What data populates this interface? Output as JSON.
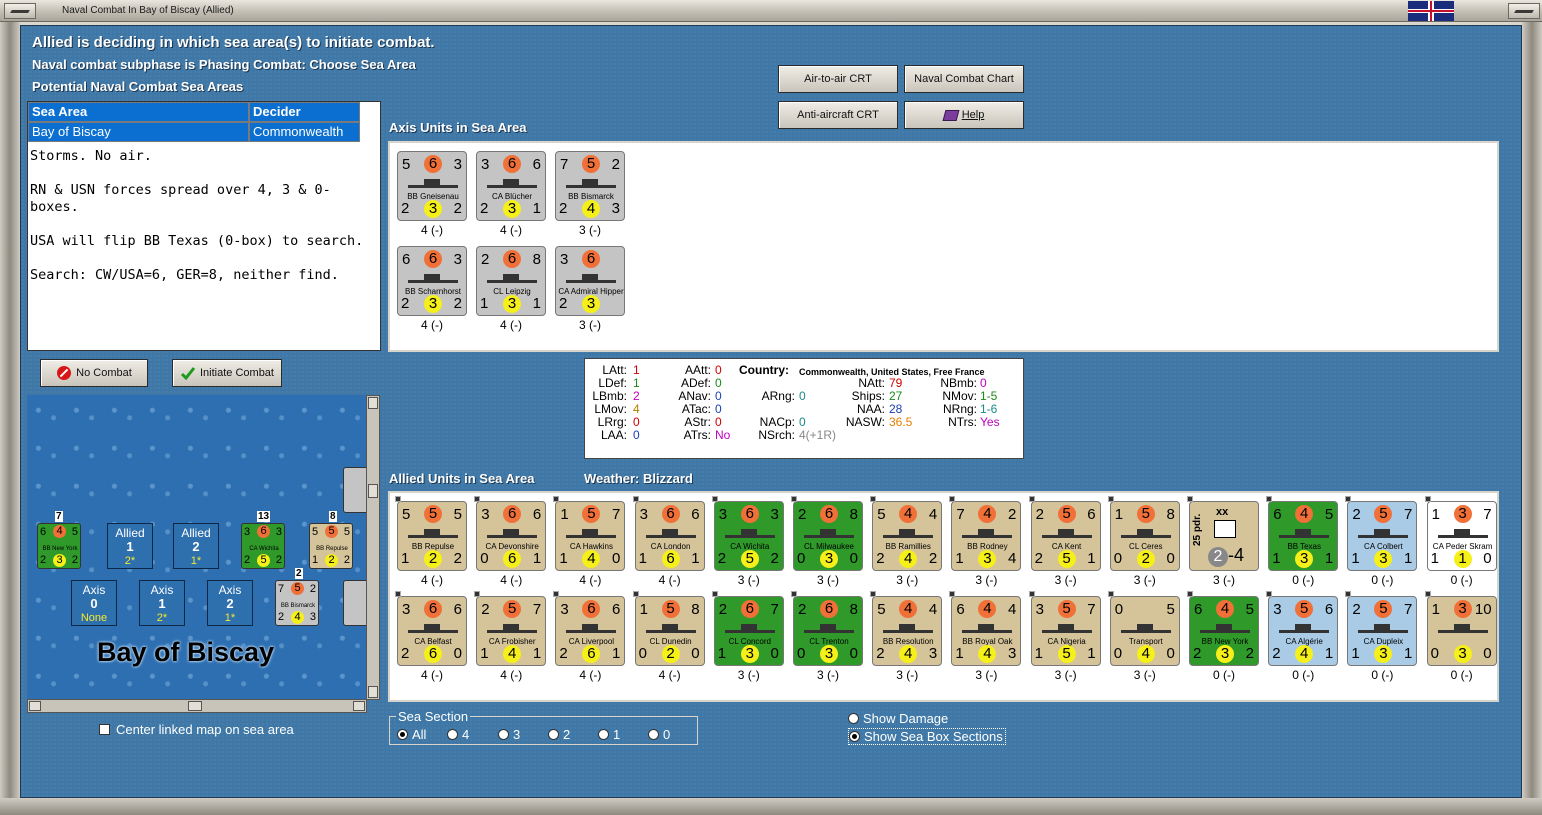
{
  "window": {
    "title": "Naval Combat In Bay of Biscay (Allied)"
  },
  "header": {
    "line1": "Allied is deciding in which sea area(s) to initiate combat.",
    "line2": "Naval combat subphase is Phasing Combat: Choose Sea Area",
    "line3": "Potential Naval Combat Sea Areas"
  },
  "table": {
    "headers": [
      "Sea Area",
      "Decider"
    ],
    "rows": [
      [
        "Bay of Biscay",
        "Commonwealth"
      ]
    ]
  },
  "notes": [
    "Storms.  No air.",
    "RN & USN forces spread over 4, 3 & 0-boxes.",
    "USA will flip BB Texas (0-box) to search.",
    "Search:  CW/USA=6, GER=8, neither find."
  ],
  "buttons": {
    "air_to_air": "Air-to-air CRT",
    "naval_chart": "Naval Combat Chart",
    "anti_aircraft": "Anti-aircraft CRT",
    "help": "Help",
    "no_combat": "No Combat",
    "initiate_combat": "Initiate Combat"
  },
  "axis_section": {
    "title": "Axis Units in Sea Area"
  },
  "allied_section": {
    "title": "Allied Units in Sea Area",
    "weather": "Weather:  Blizzard"
  },
  "info": {
    "country_label": "Country:",
    "country_value": "Commonwealth, United States, Free France",
    "col1": [
      [
        "LAtt:",
        "1"
      ],
      [
        "LDef:",
        "1"
      ],
      [
        "LBmb:",
        "2"
      ],
      [
        "LMov:",
        "4"
      ],
      [
        "LRrg:",
        "0"
      ],
      [
        "LAA:",
        "0"
      ]
    ],
    "col2": [
      [
        "AAtt:",
        "0"
      ],
      [
        "ADef:",
        "0"
      ],
      [
        "ANav:",
        "0"
      ],
      [
        "ATac:",
        "0"
      ],
      [
        "AStr:",
        "0"
      ],
      [
        "ATrs:",
        "No"
      ]
    ],
    "col3": [
      [
        "ARng:",
        "0"
      ],
      [
        "NACp:",
        "0"
      ],
      [
        "NSrch:",
        "4(+1R)"
      ]
    ],
    "col4": [
      [
        "NAtt:",
        "79"
      ],
      [
        "Ships:",
        "27"
      ],
      [
        "NAA:",
        "28"
      ],
      [
        "NASW:",
        "36.5"
      ]
    ],
    "col5": [
      [
        "NBmb:",
        "0"
      ],
      [
        "NMov:",
        "1-5"
      ],
      [
        "NRng:",
        "1-6"
      ],
      [
        "NTrs:",
        "Yes"
      ]
    ]
  },
  "axis_units": [
    {
      "name": "BB Gneisenau",
      "a": "5",
      "o": "6",
      "b": "3",
      "c": "2",
      "y": "3",
      "d": "2",
      "sub": "4 (-)"
    },
    {
      "name": "CA Blücher",
      "a": "3",
      "o": "6",
      "b": "6",
      "c": "2",
      "y": "3",
      "d": "1",
      "sub": "4 (-)"
    },
    {
      "name": "BB Bismarck",
      "a": "7",
      "o": "5",
      "b": "2",
      "c": "2",
      "y": "4",
      "d": "3",
      "sub": "3 (-)"
    },
    {
      "name": "BB Scharnhorst",
      "a": "6",
      "o": "6",
      "b": "3",
      "c": "2",
      "y": "3",
      "d": "2",
      "sub": "4 (-)"
    },
    {
      "name": "CL Leipzig",
      "a": "2",
      "o": "6",
      "b": "8",
      "c": "1",
      "y": "3",
      "d": "1",
      "sub": "4 (-)"
    },
    {
      "name": "CA Admiral Hipper",
      "a": "3",
      "o": "6",
      "b": "",
      "c": "2",
      "y": "3",
      "d": "",
      "sub": "3 (-)"
    }
  ],
  "allied_row1": [
    {
      "name": "BB Repulse",
      "a": "5",
      "o": "5",
      "b": "5",
      "c": "1",
      "y": "2",
      "d": "2",
      "sub": "4 (-)",
      "color": "tan"
    },
    {
      "name": "CA Devonshire",
      "a": "3",
      "o": "6",
      "b": "6",
      "c": "0",
      "y": "6",
      "d": "1",
      "sub": "4 (-)",
      "color": "tan"
    },
    {
      "name": "CA Hawkins",
      "a": "1",
      "o": "5",
      "b": "7",
      "c": "1",
      "y": "4",
      "d": "0",
      "sub": "4 (-)",
      "color": "tan"
    },
    {
      "name": "CA London",
      "a": "3",
      "o": "6",
      "b": "6",
      "c": "1",
      "y": "6",
      "d": "1",
      "sub": "4 (-)",
      "color": "tan"
    },
    {
      "name": "CA Wichita",
      "a": "3",
      "o": "6",
      "b": "3",
      "c": "2",
      "y": "5",
      "d": "2",
      "sub": "3 (-)",
      "color": "green"
    },
    {
      "name": "CL Milwaukee",
      "a": "2",
      "o": "6",
      "b": "8",
      "c": "0",
      "y": "3",
      "d": "0",
      "sub": "3 (-)",
      "color": "green"
    },
    {
      "name": "BB Ramillies",
      "a": "5",
      "o": "4",
      "b": "4",
      "c": "2",
      "y": "4",
      "d": "2",
      "sub": "3 (-)",
      "color": "tan"
    },
    {
      "name": "BB Rodney",
      "a": "7",
      "o": "4",
      "b": "2",
      "c": "1",
      "y": "3",
      "d": "4",
      "sub": "3 (-)",
      "color": "tan"
    },
    {
      "name": "CA Kent",
      "a": "2",
      "o": "5",
      "b": "6",
      "c": "2",
      "y": "5",
      "d": "1",
      "sub": "3 (-)",
      "color": "tan"
    },
    {
      "name": "CL Ceres",
      "a": "1",
      "o": "5",
      "b": "8",
      "c": "0",
      "y": "2",
      "d": "0",
      "sub": "3 (-)",
      "color": "tan"
    },
    {
      "name": "25 pdr.",
      "a": "",
      "o": "",
      "b": "",
      "c": "2",
      "y": "",
      "d": "4",
      "sub": "3 (-)",
      "color": "tan",
      "special": "xx"
    },
    {
      "name": "BB Texas",
      "a": "6",
      "o": "4",
      "b": "5",
      "c": "1",
      "y": "3",
      "d": "1",
      "sub": "0 (-)",
      "color": "green"
    },
    {
      "name": "CA Colbert",
      "a": "2",
      "o": "5",
      "b": "7",
      "c": "1",
      "y": "3",
      "d": "1",
      "sub": "0 (-)",
      "color": "blue"
    },
    {
      "name": "CA Peder Skram",
      "a": "1",
      "o": "3",
      "b": "7",
      "c": "1",
      "y": "1",
      "d": "0",
      "sub": "0 (-)",
      "color": "white"
    }
  ],
  "allied_row2": [
    {
      "name": "CA Belfast",
      "a": "3",
      "o": "6",
      "b": "6",
      "c": "2",
      "y": "6",
      "d": "0",
      "sub": "4 (-)",
      "color": "tan"
    },
    {
      "name": "CA Frobisher",
      "a": "2",
      "o": "5",
      "b": "7",
      "c": "1",
      "y": "4",
      "d": "1",
      "sub": "4 (-)",
      "color": "tan"
    },
    {
      "name": "CA Liverpool",
      "a": "3",
      "o": "6",
      "b": "6",
      "c": "2",
      "y": "6",
      "d": "1",
      "sub": "4 (-)",
      "color": "tan"
    },
    {
      "name": "CL Dunedin",
      "a": "1",
      "o": "5",
      "b": "8",
      "c": "0",
      "y": "2",
      "d": "0",
      "sub": "4 (-)",
      "color": "tan"
    },
    {
      "name": "CL Concord",
      "a": "2",
      "o": "6",
      "b": "7",
      "c": "1",
      "y": "3",
      "d": "0",
      "sub": "3 (-)",
      "color": "green"
    },
    {
      "name": "CL Trenton",
      "a": "2",
      "o": "6",
      "b": "8",
      "c": "0",
      "y": "3",
      "d": "0",
      "sub": "3 (-)",
      "color": "green"
    },
    {
      "name": "BB Resolution",
      "a": "5",
      "o": "4",
      "b": "4",
      "c": "2",
      "y": "4",
      "d": "3",
      "sub": "3 (-)",
      "color": "tan"
    },
    {
      "name": "BB Royal Oak",
      "a": "6",
      "o": "4",
      "b": "4",
      "c": "1",
      "y": "4",
      "d": "3",
      "sub": "3 (-)",
      "color": "tan"
    },
    {
      "name": "CA Nigeria",
      "a": "3",
      "o": "5",
      "b": "7",
      "c": "1",
      "y": "5",
      "d": "1",
      "sub": "3 (-)",
      "color": "tan"
    },
    {
      "name": "Transport",
      "a": "0",
      "o": "",
      "b": "5",
      "c": "0",
      "y": "4",
      "d": "0",
      "sub": "3 (-)",
      "color": "tan"
    },
    {
      "name": "BB New York",
      "a": "6",
      "o": "4",
      "b": "5",
      "c": "2",
      "y": "3",
      "d": "2",
      "sub": "0 (-)",
      "color": "green"
    },
    {
      "name": "CA Algérie",
      "a": "3",
      "o": "5",
      "b": "6",
      "c": "2",
      "y": "4",
      "d": "1",
      "sub": "0 (-)",
      "color": "blue"
    },
    {
      "name": "CA Dupleix",
      "a": "2",
      "o": "5",
      "b": "7",
      "c": "1",
      "y": "3",
      "d": "1",
      "sub": "0 (-)",
      "color": "blue"
    },
    {
      "name": "",
      "a": "1",
      "o": "3",
      "b": "10",
      "c": "0",
      "y": "3",
      "d": "0",
      "sub": "0 (-)",
      "color": "tan"
    }
  ],
  "map": {
    "title": "Bay of Biscay",
    "allied_boxes": [
      {
        "label": "Allied",
        "num": "1",
        "val": "2*"
      },
      {
        "label": "Allied",
        "num": "2",
        "val": "1*"
      }
    ],
    "axis_boxes": [
      {
        "label": "Axis",
        "num": "0",
        "val": "None"
      },
      {
        "label": "Axis",
        "num": "1",
        "val": "2*"
      },
      {
        "label": "Axis",
        "num": "2",
        "val": "1*"
      }
    ],
    "mini": [
      {
        "name": "BB New York",
        "stack": "7"
      },
      {
        "name": "CA Wichita",
        "stack": "13"
      },
      {
        "name": "BB Repulse",
        "stack": "8"
      },
      {
        "name": "BB Bismarck",
        "stack": "2"
      }
    ]
  },
  "center_map": {
    "label": "Center linked map on sea area"
  },
  "sea_section": {
    "title": "Sea Section",
    "options": [
      "All",
      "4",
      "3",
      "2",
      "1",
      "0"
    ],
    "selected": "All"
  },
  "show": {
    "damage": "Show Damage",
    "sections": "Show Sea Box Sections"
  }
}
